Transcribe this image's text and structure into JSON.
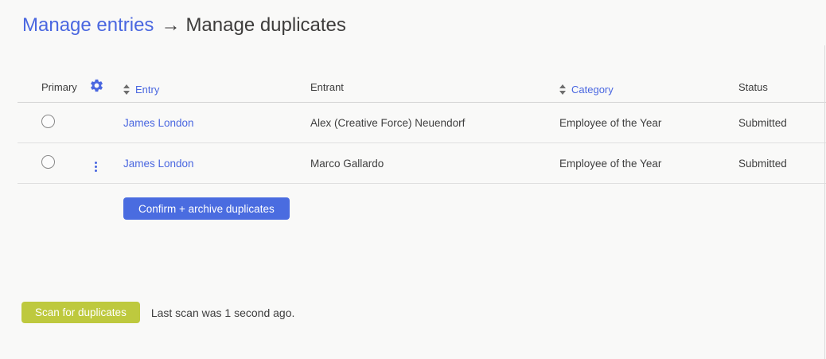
{
  "breadcrumb": {
    "link_label": "Manage entries",
    "separator": "→",
    "current_label": "Manage duplicates"
  },
  "table": {
    "headers": {
      "primary": "Primary",
      "entry": "Entry",
      "entrant": "Entrant",
      "category": "Category",
      "status": "Status"
    },
    "rows": [
      {
        "entry": "James London",
        "entrant": "Alex (Creative Force) Neuendorf",
        "category": "Employee of the Year",
        "status": "Submitted"
      },
      {
        "entry": "James London",
        "entrant": "Marco Gallardo",
        "category": "Employee of the Year",
        "status": "Submitted"
      }
    ]
  },
  "actions": {
    "confirm_button_label": "Confirm + archive duplicates",
    "scan_button_label": "Scan for duplicates",
    "last_scan_text": "Last scan was 1 second ago."
  },
  "icons": {
    "settings_column": "gear-icon",
    "row_menu": "kebab-menu-icon",
    "sortable_column": "sort-arrows-icon"
  },
  "colors": {
    "link_blue": "#4a67e0",
    "confirm_button_blue": "#4a6ce0",
    "scan_button_green": "#bec93e",
    "heading_text": "#3d3c3b",
    "background": "#f9f9f8",
    "header_border": "#d2d2d2",
    "row_border": "#e0e0e0"
  }
}
